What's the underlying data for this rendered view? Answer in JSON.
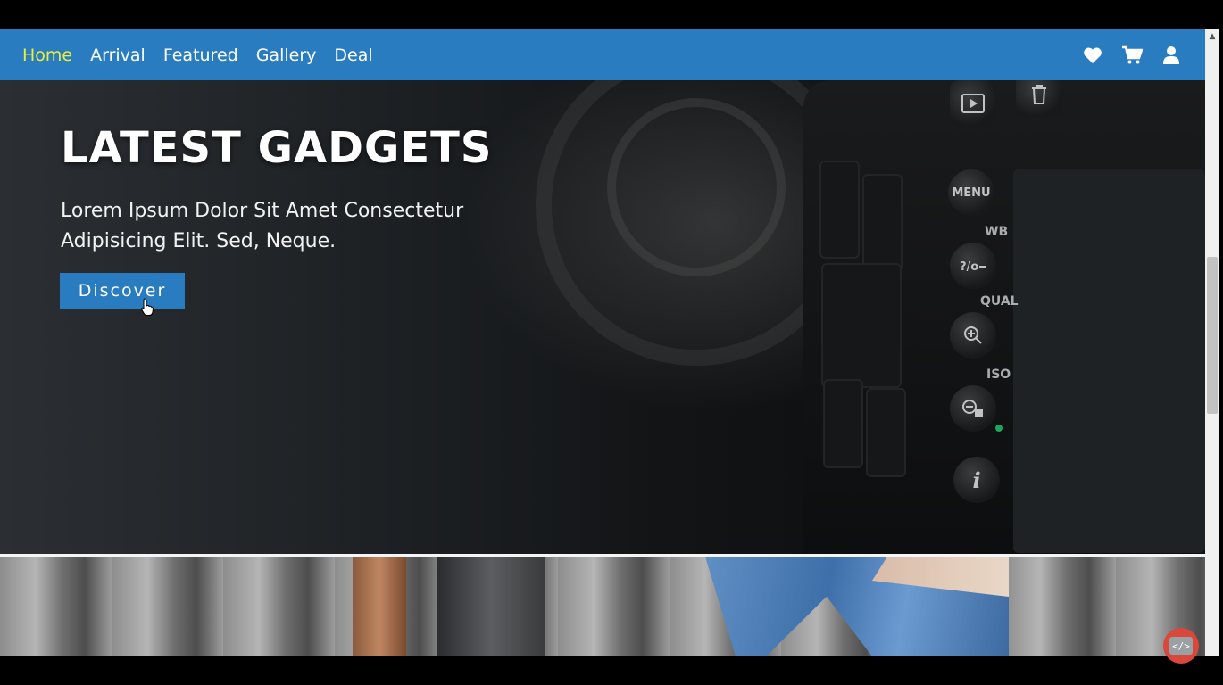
{
  "nav": {
    "links": [
      {
        "label": "Home",
        "active": true
      },
      {
        "label": "Arrival",
        "active": false
      },
      {
        "label": "Featured",
        "active": false
      },
      {
        "label": "Gallery",
        "active": false
      },
      {
        "label": "Deal",
        "active": false
      }
    ],
    "icons": [
      "heart-icon",
      "cart-icon",
      "user-icon"
    ],
    "active_color": "#e8f03c",
    "bar_color": "#2a7cc0"
  },
  "hero": {
    "title": "LATEST GADGETS",
    "subtitle": "Lorem Ipsum Dolor Sit Amet Consectetur Adipisicing Elit. Sed, Neque.",
    "button_label": "Discover",
    "camera_labels": {
      "menu": "MENU",
      "wb": "WB",
      "qual": "QUAL",
      "iso": "ISO",
      "info": "i"
    }
  },
  "badge": {
    "label": "</>"
  }
}
